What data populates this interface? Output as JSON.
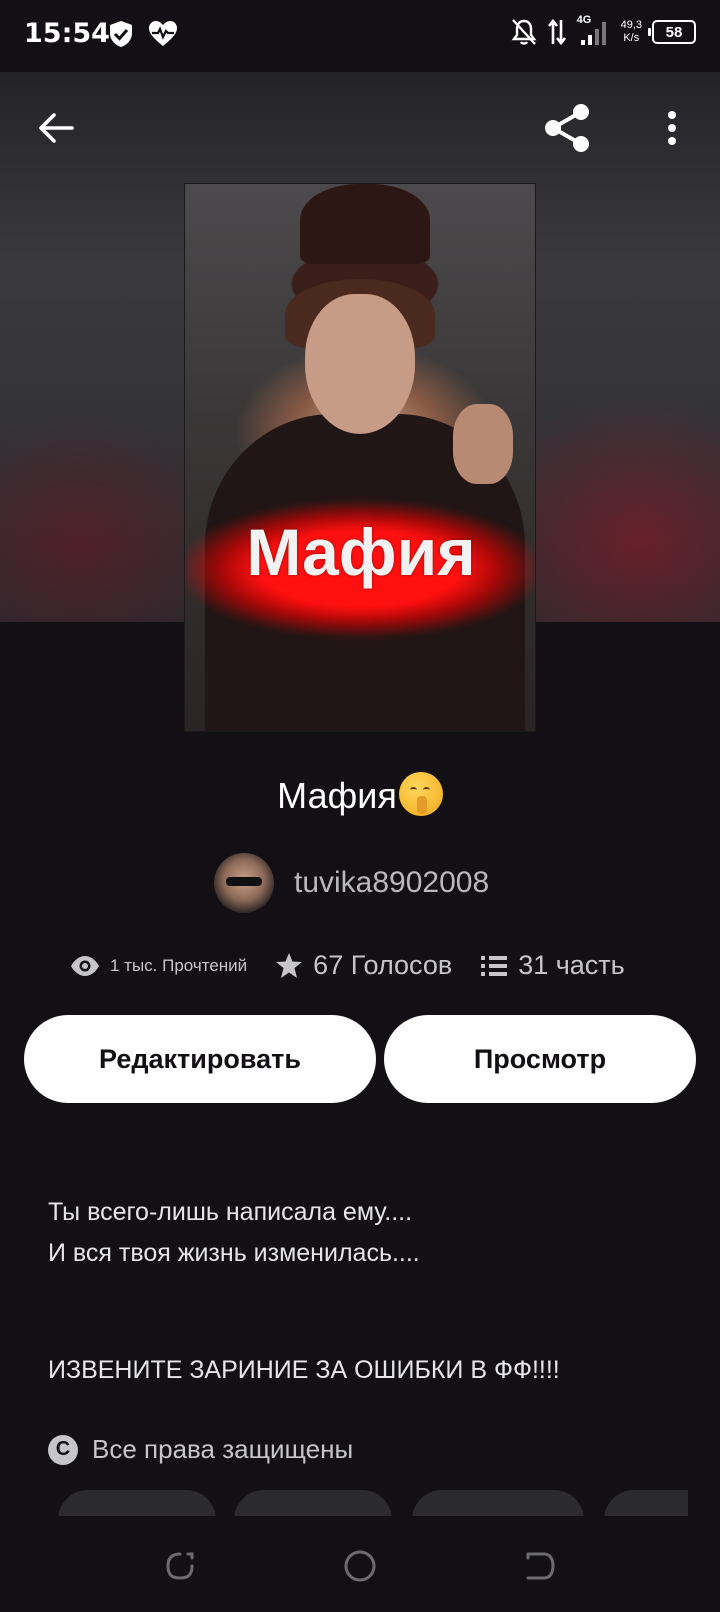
{
  "status_bar": {
    "time": "15:54",
    "left_icons": [
      "shield-check-icon",
      "heart-pulse-icon"
    ],
    "right_icons": [
      "notifications-off-icon",
      "data-arrows-icon",
      "signal-4g-icon"
    ],
    "network_label": "4G",
    "net_speed_value": "49,3",
    "net_speed_unit": "K/s",
    "battery": "58"
  },
  "top_nav": {
    "back_icon": "arrow-left-icon",
    "share_icon": "share-icon",
    "more_icon": "more-vertical-icon"
  },
  "cover": {
    "title": "Мафия",
    "accent_color": "#ff1010"
  },
  "story": {
    "title": "Мафия",
    "title_emoji": "shushing-face-emoji",
    "author": "tuvika8902008"
  },
  "stats": {
    "reads": "1 тыс. Прочтений",
    "votes": "67 Голосов",
    "parts": "31 часть"
  },
  "actions": {
    "edit_label": "Редактировать",
    "view_label": "Просмотр"
  },
  "description": {
    "line1": "Ты всего-лишь написала ему....",
    "line2": "И вся твоя жизнь изменилась....",
    "line3": "ИЗВЕНИТЕ ЗАРИНИЕ ЗА ОШИБКИ В ФФ!!!!"
  },
  "rights": {
    "label": "Все права защищены"
  },
  "colors": {
    "background": "#121014",
    "button_bg": "#ffffff",
    "muted_text": "#c6c6ca"
  }
}
